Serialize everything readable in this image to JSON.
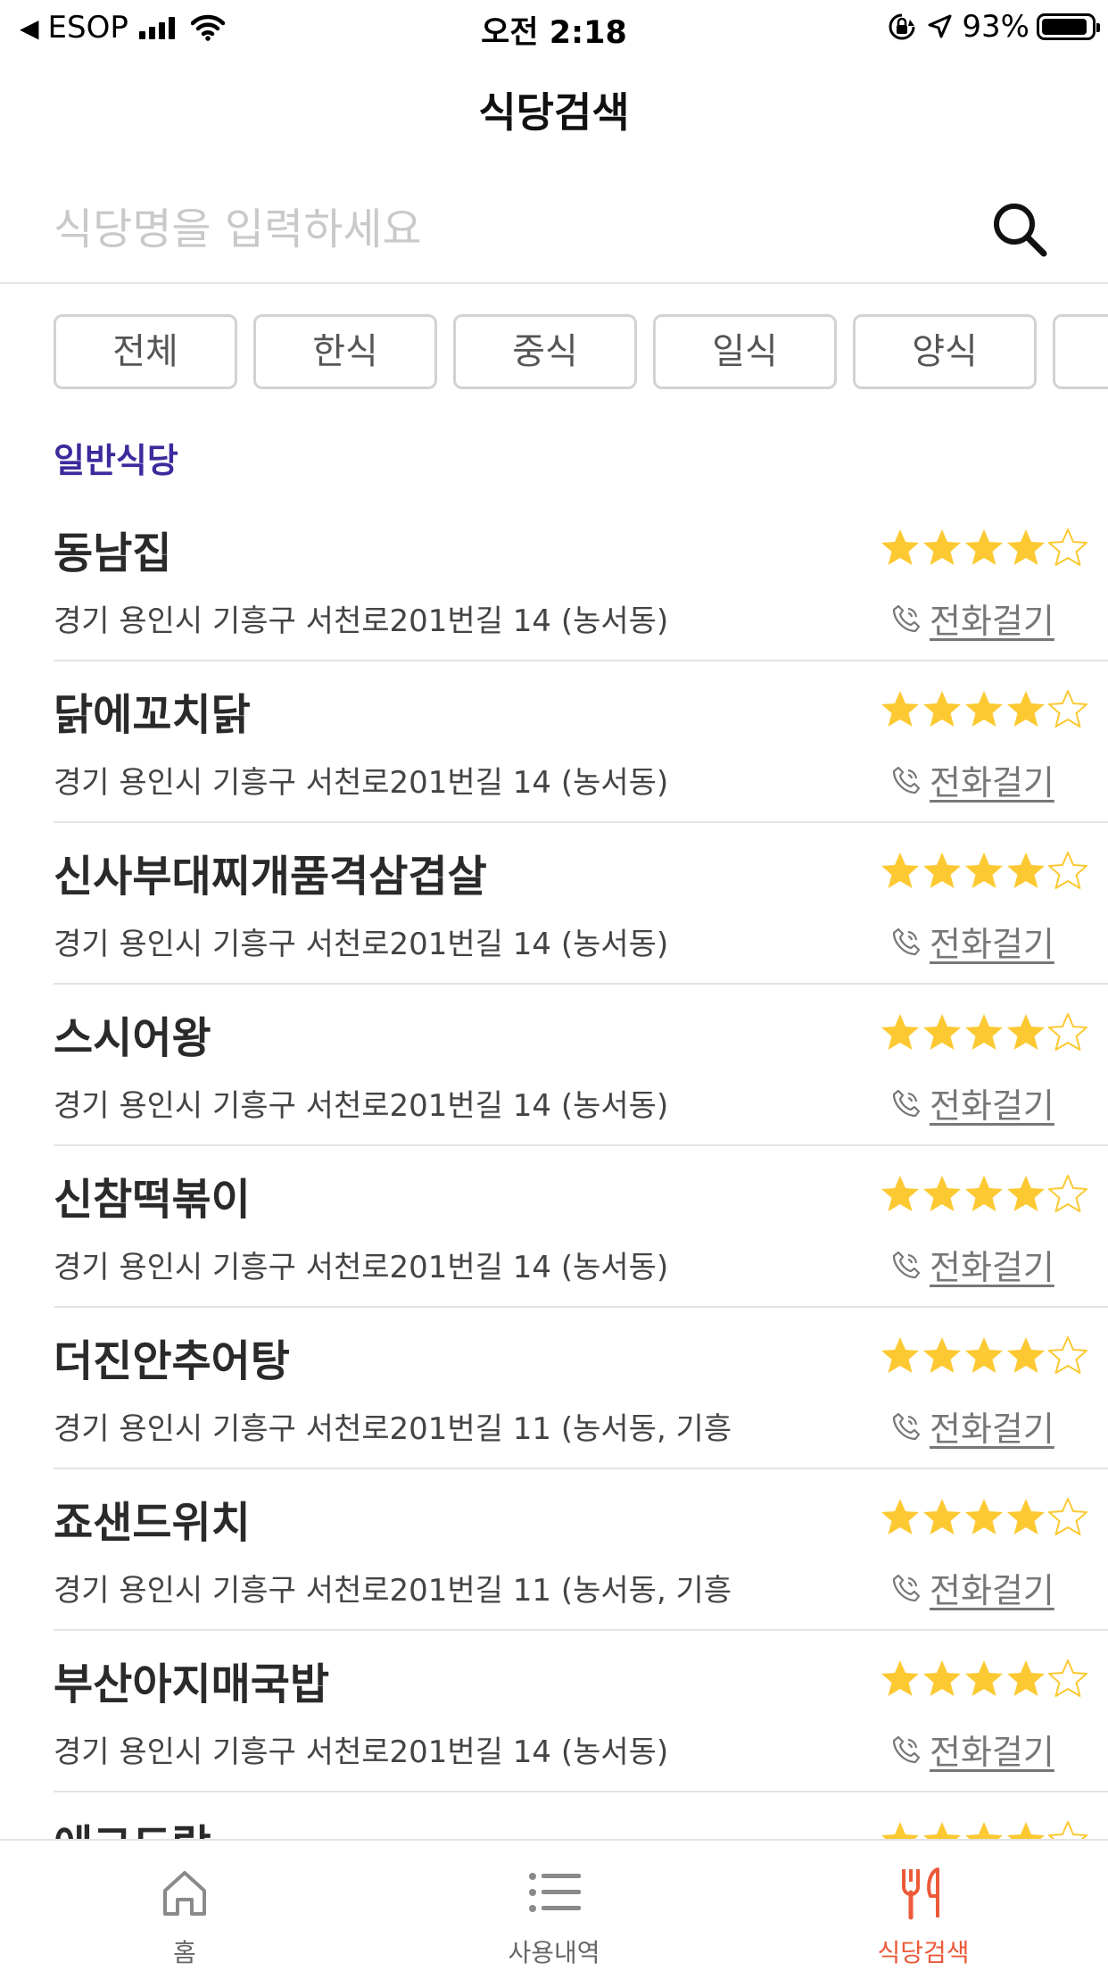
{
  "status_bar": {
    "back_glyph": "◀",
    "carrier": "ESOP",
    "time": "오전 2:18",
    "battery_percent": "93%",
    "battery_level": 0.93
  },
  "nav": {
    "title": "식당검색"
  },
  "search": {
    "placeholder": "식당명을 입력하세요",
    "value": ""
  },
  "filters": [
    "전체",
    "한식",
    "중식",
    "일식",
    "양식",
    ""
  ],
  "section_title": "일반식당",
  "call_label": "전화걸기",
  "restaurants": [
    {
      "name": "동남집",
      "address": "경기 용인시 기흥구 서천로201번길 14 (농서동)",
      "rating": 4
    },
    {
      "name": "닭에꼬치닭",
      "address": "경기 용인시 기흥구 서천로201번길 14 (농서동)",
      "rating": 4
    },
    {
      "name": "신사부대찌개품격삼겹살",
      "address": "경기 용인시 기흥구 서천로201번길 14 (농서동)",
      "rating": 4
    },
    {
      "name": "스시어왕",
      "address": "경기 용인시 기흥구 서천로201번길 14 (농서동)",
      "rating": 4
    },
    {
      "name": "신참떡볶이",
      "address": "경기 용인시 기흥구 서천로201번길 14 (농서동)",
      "rating": 4
    },
    {
      "name": "더진안추어탕",
      "address": "경기 용인시 기흥구 서천로201번길 11 (농서동, 기흥",
      "rating": 4
    },
    {
      "name": "죠샌드위치",
      "address": "경기 용인시 기흥구 서천로201번길 11 (농서동, 기흥",
      "rating": 4
    },
    {
      "name": "부산아지매국밥",
      "address": "경기 용인시 기흥구 서천로201번길 14 (농서동)",
      "rating": 4
    },
    {
      "name": "에그드랍",
      "address": "",
      "rating": 4
    }
  ],
  "tabs": [
    {
      "label": "홈",
      "icon": "home-icon",
      "active": false
    },
    {
      "label": "사용내역",
      "icon": "list-icon",
      "active": false
    },
    {
      "label": "식당검색",
      "icon": "utensils-icon",
      "active": true
    }
  ],
  "colors": {
    "accent": "#ec5a3a",
    "section_title": "#3d2a9c",
    "star_filled": "#fcc932",
    "star_empty_outline": "#fcc932"
  }
}
